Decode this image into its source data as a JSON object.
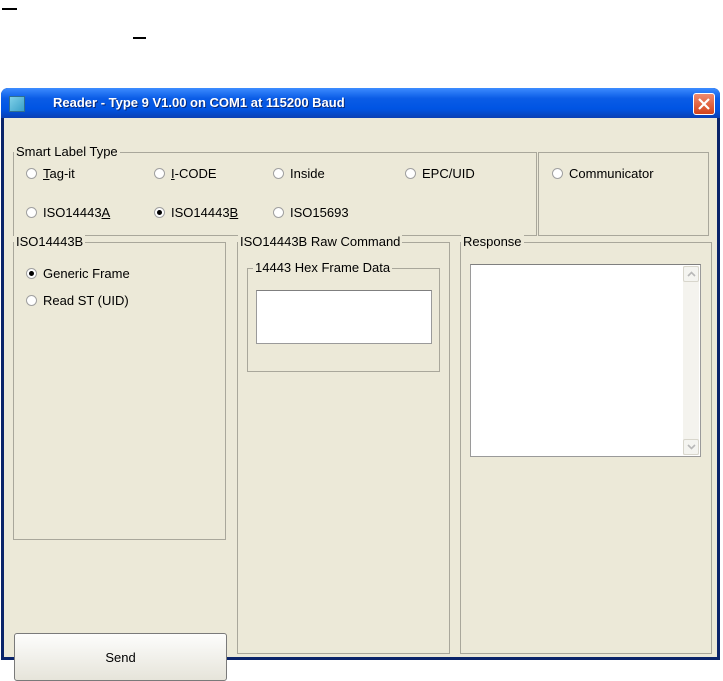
{
  "window": {
    "title": "Reader - Type 9 V1.00 on COM1 at 115200 Baud"
  },
  "smart_label_type": {
    "legend": "Smart Label Type",
    "options": [
      {
        "pre": "",
        "u": "T",
        "post": "ag-it",
        "selected": false
      },
      {
        "pre": "",
        "u": "I",
        "post": "-CODE",
        "selected": false
      },
      {
        "pre": "Inside",
        "u": "",
        "post": "",
        "selected": false
      },
      {
        "pre": "EPC/UID",
        "u": "",
        "post": "",
        "selected": false
      },
      {
        "pre": "ISO14443",
        "u": "A",
        "post": "",
        "selected": false
      },
      {
        "pre": "ISO14443",
        "u": "B",
        "post": "",
        "selected": true
      },
      {
        "pre": "ISO15693",
        "u": "",
        "post": "",
        "selected": false
      }
    ],
    "communicator": {
      "label": "Communicator",
      "selected": false
    }
  },
  "iso14443b": {
    "legend": "ISO14443B",
    "options": [
      {
        "label": "Generic Frame",
        "selected": true
      },
      {
        "label": "Read ST (UID)",
        "selected": false
      }
    ]
  },
  "raw_command": {
    "legend": "ISO14443B Raw Command",
    "hex_frame": {
      "legend": "14443 Hex Frame Data",
      "value": ""
    }
  },
  "response": {
    "legend": "Response",
    "value": ""
  },
  "send_button": {
    "label": "Send"
  },
  "colors": {
    "titlebar": "#0054e3",
    "client_bg": "#ece9d8",
    "close_button": "#d3431b"
  }
}
